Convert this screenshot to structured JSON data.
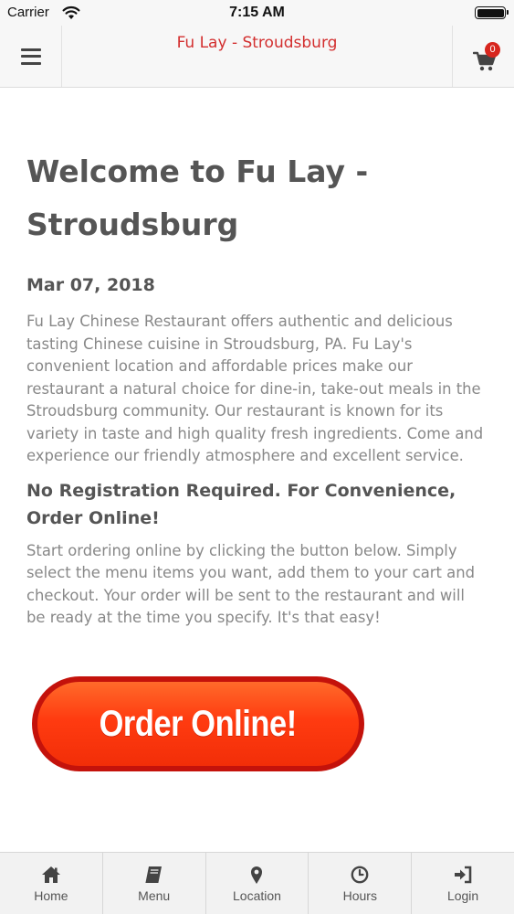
{
  "status_bar": {
    "carrier": "Carrier",
    "time": "7:15 AM"
  },
  "header": {
    "title": "Fu Lay - Stroudsburg",
    "cart_count": "0",
    "title_color": "#d32f2f"
  },
  "main": {
    "welcome_title": "Welcome to Fu Lay - Stroudsburg",
    "date": "Mar 07, 2018",
    "description": "Fu Lay Chinese Restaurant offers authentic and delicious tasting Chinese cuisine in Stroudsburg, PA.  Fu Lay's convenient location and affordable prices make our restaurant a natural choice for dine-in, take-out meals in the Stroudsburg community. Our restaurant is known for its variety in taste and high quality fresh ingredients. Come and experience our friendly atmosphere and excellent service.",
    "subheading": "No Registration Required. For Convenience, Order Online!",
    "instructions": "Start ordering online by clicking the button below. Simply select the menu items you want, add them to your cart and checkout. Your order will be sent to the restaurant and will be ready at the time you specify. It's that easy!",
    "order_button_label": "Order Online!"
  },
  "tab_bar": {
    "tabs": [
      {
        "label": "Home",
        "icon": "home-icon"
      },
      {
        "label": "Menu",
        "icon": "book-icon"
      },
      {
        "label": "Location",
        "icon": "map-marker-icon"
      },
      {
        "label": "Hours",
        "icon": "clock-icon"
      },
      {
        "label": "Login",
        "icon": "login-icon"
      }
    ]
  }
}
